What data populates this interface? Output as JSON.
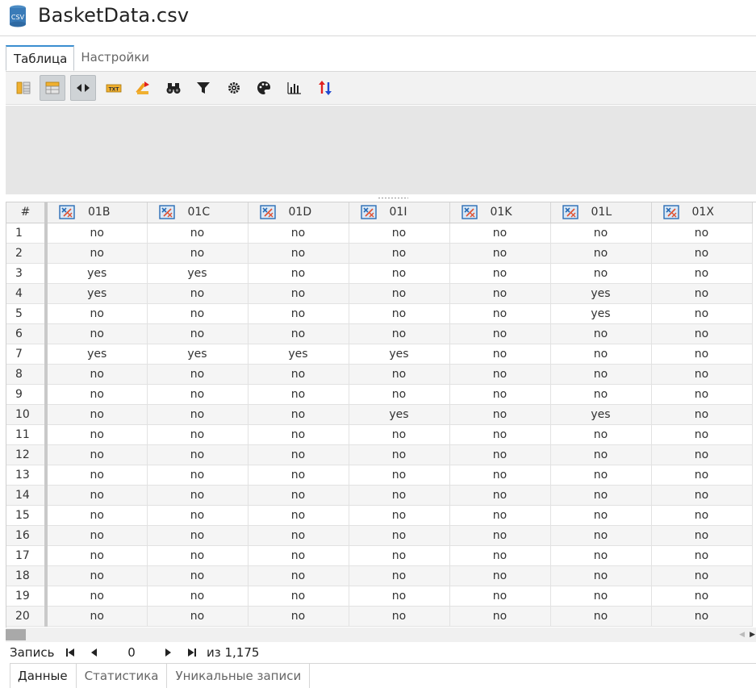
{
  "document": {
    "title": "BasketData.csv",
    "icon_text": "CSV"
  },
  "top_tabs": [
    {
      "label": "Таблица",
      "active": true
    },
    {
      "label": "Настройки",
      "active": false
    }
  ],
  "toolbar": {
    "buttons": [
      {
        "name": "columns-panel-icon",
        "pressed": false
      },
      {
        "name": "table-header-icon",
        "pressed": true
      },
      {
        "name": "resize-columns-icon",
        "pressed": true
      },
      {
        "name": "txt-export-icon",
        "pressed": false
      },
      {
        "name": "sort-az-icon",
        "pressed": false
      },
      {
        "name": "binoculars-find-icon",
        "pressed": false
      },
      {
        "name": "filter-funnel-icon",
        "pressed": false
      },
      {
        "name": "gear-settings-icon",
        "pressed": false
      },
      {
        "name": "palette-icon",
        "pressed": false
      },
      {
        "name": "bar-chart-icon",
        "pressed": false
      },
      {
        "name": "sort-up-down-icon",
        "pressed": false
      }
    ]
  },
  "grid": {
    "rownum_header": "#",
    "columns": [
      "01B",
      "01C",
      "01D",
      "01I",
      "01K",
      "01L",
      "01X"
    ],
    "rows": [
      {
        "n": "1",
        "cells": [
          "no",
          "no",
          "no",
          "no",
          "no",
          "no",
          "no"
        ]
      },
      {
        "n": "2",
        "cells": [
          "no",
          "no",
          "no",
          "no",
          "no",
          "no",
          "no"
        ]
      },
      {
        "n": "3",
        "cells": [
          "yes",
          "yes",
          "no",
          "no",
          "no",
          "no",
          "no"
        ]
      },
      {
        "n": "4",
        "cells": [
          "yes",
          "no",
          "no",
          "no",
          "no",
          "yes",
          "no"
        ]
      },
      {
        "n": "5",
        "cells": [
          "no",
          "no",
          "no",
          "no",
          "no",
          "yes",
          "no"
        ]
      },
      {
        "n": "6",
        "cells": [
          "no",
          "no",
          "no",
          "no",
          "no",
          "no",
          "no"
        ]
      },
      {
        "n": "7",
        "cells": [
          "yes",
          "yes",
          "yes",
          "yes",
          "no",
          "no",
          "no"
        ]
      },
      {
        "n": "8",
        "cells": [
          "no",
          "no",
          "no",
          "no",
          "no",
          "no",
          "no"
        ]
      },
      {
        "n": "9",
        "cells": [
          "no",
          "no",
          "no",
          "no",
          "no",
          "no",
          "no"
        ]
      },
      {
        "n": "10",
        "cells": [
          "no",
          "no",
          "no",
          "yes",
          "no",
          "yes",
          "no"
        ]
      },
      {
        "n": "11",
        "cells": [
          "no",
          "no",
          "no",
          "no",
          "no",
          "no",
          "no"
        ]
      },
      {
        "n": "12",
        "cells": [
          "no",
          "no",
          "no",
          "no",
          "no",
          "no",
          "no"
        ]
      },
      {
        "n": "13",
        "cells": [
          "no",
          "no",
          "no",
          "no",
          "no",
          "no",
          "no"
        ]
      },
      {
        "n": "14",
        "cells": [
          "no",
          "no",
          "no",
          "no",
          "no",
          "no",
          "no"
        ]
      },
      {
        "n": "15",
        "cells": [
          "no",
          "no",
          "no",
          "no",
          "no",
          "no",
          "no"
        ]
      },
      {
        "n": "16",
        "cells": [
          "no",
          "no",
          "no",
          "no",
          "no",
          "no",
          "no"
        ]
      },
      {
        "n": "17",
        "cells": [
          "no",
          "no",
          "no",
          "no",
          "no",
          "no",
          "no"
        ]
      },
      {
        "n": "18",
        "cells": [
          "no",
          "no",
          "no",
          "no",
          "no",
          "no",
          "no"
        ]
      },
      {
        "n": "19",
        "cells": [
          "no",
          "no",
          "no",
          "no",
          "no",
          "no",
          "no"
        ]
      },
      {
        "n": "20",
        "cells": [
          "no",
          "no",
          "no",
          "no",
          "no",
          "no",
          "no"
        ]
      }
    ]
  },
  "navigator": {
    "label": "Запись",
    "current": "0",
    "total": "из 1,175"
  },
  "bottom_tabs": [
    {
      "label": "Данные",
      "active": true
    },
    {
      "label": "Статистика",
      "active": false
    },
    {
      "label": "Уникальные записи",
      "active": false
    }
  ],
  "colors": {
    "accent": "#3a8ed0",
    "toolbar_bg": "#f2f2f2",
    "panel_bg": "#e6e6e6",
    "icon_orange": "#f0a020",
    "icon_blue": "#2a6db5",
    "icon_red": "#e02020"
  }
}
